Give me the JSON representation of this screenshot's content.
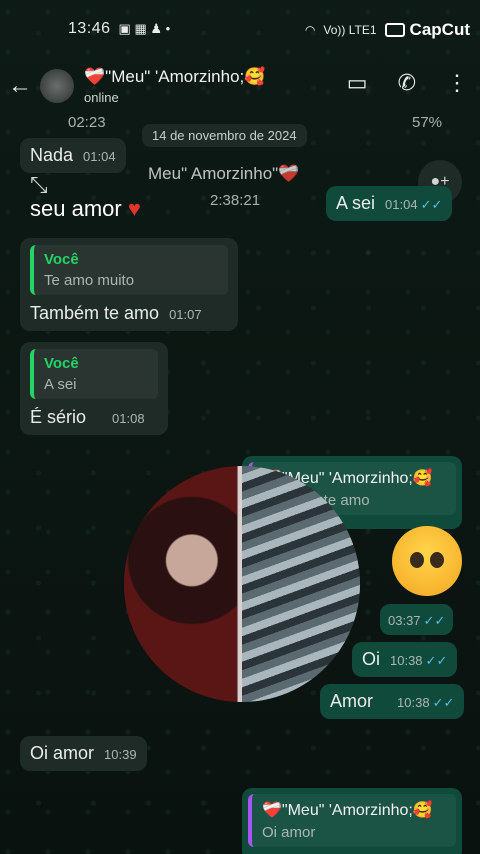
{
  "status": {
    "time": "13:46",
    "battery": "100",
    "network": "Vo)) LTE1"
  },
  "capcut": "CapCut",
  "header": {
    "title": "❤️‍🩹\"Meu\" 'Amorzinho;🥰",
    "subtitle": "online"
  },
  "date_pill": "14 de novembro de 2024",
  "overlay": {
    "top_time": "02:23",
    "inner_title": "Meu\" Amorzinho\"❤️‍🩹",
    "inner_time": "2:38:21",
    "seu_amor": "seu amor",
    "battery_text": "57%"
  },
  "messages": {
    "m1": {
      "text": "Nada",
      "time": "01:04"
    },
    "m2": {
      "text": "A sei",
      "time": "01:04"
    },
    "m3": {
      "quote_who": "Você",
      "quote_text": "Te amo muito",
      "text": "Também te amo",
      "time": "01:07"
    },
    "m4": {
      "quote_who": "Você",
      "quote_text": "A sei",
      "text": "É sério",
      "time": "01:08"
    },
    "m5": {
      "quote_who": "❤️‍🩹\"Meu\" 'Amorzinho;🥰",
      "quote_text": "Também te amo"
    },
    "m6": {
      "time": "03:37"
    },
    "m7": {
      "text": "Oi",
      "time": "10:38"
    },
    "m8": {
      "text": "Amor",
      "time": "10:38"
    },
    "m9": {
      "text": "Oi amor",
      "time": "10:39"
    },
    "m10": {
      "quote_who": "❤️‍🩹\"Meu\" 'Amorzinho;🥰",
      "quote_text": "Oi amor"
    }
  },
  "icons": [
    "back-arrow-icon",
    "video-call-icon",
    "phone-icon",
    "more-vert-icon",
    "double-check-icon",
    "collapse-icon",
    "heart-icon"
  ]
}
